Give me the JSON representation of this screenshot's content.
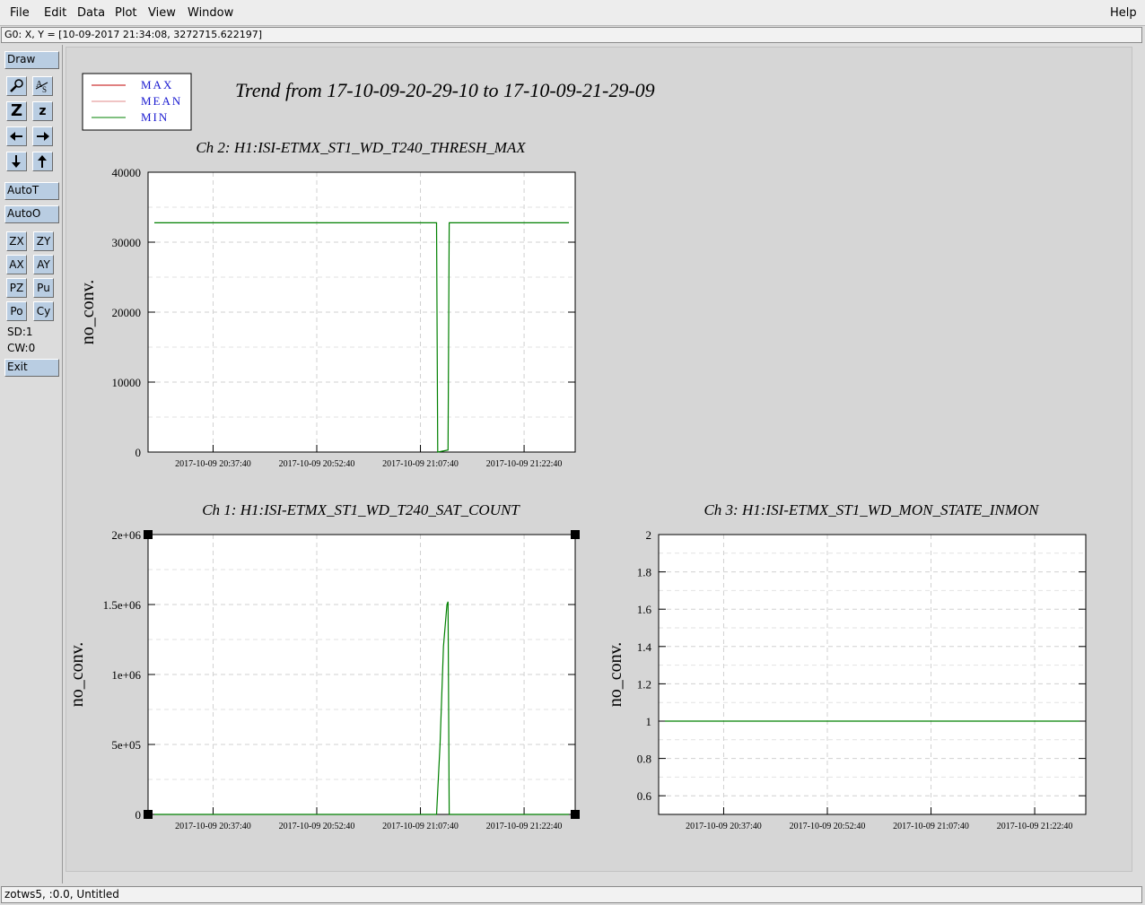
{
  "menu": {
    "file": "File",
    "edit": "Edit",
    "data": "Data",
    "plot": "Plot",
    "view": "View",
    "window": "Window",
    "help": "Help"
  },
  "coord_readout": "G0: X, Y = [10-09-2017 21:34:08, 3272715.622197]",
  "toolbar": {
    "draw": "Draw",
    "zoom_big": "Z",
    "zoom_small": "z",
    "autot": "AutoT",
    "autoo": "AutoO",
    "zx": "ZX",
    "zy": "ZY",
    "ax": "AX",
    "ay": "AY",
    "pz": "PZ",
    "pu": "Pu",
    "po": "Po",
    "cy": "Cy",
    "sd": "SD:1",
    "cw": "CW:0",
    "exit": "Exit",
    "icons": [
      "magnifier-icon",
      "text-tool-icon",
      "arrow-left-icon",
      "arrow-right-icon",
      "arrow-down-icon",
      "arrow-up-icon"
    ]
  },
  "legend": {
    "entries": [
      {
        "name": "MAX",
        "color": "#c00000"
      },
      {
        "name": "MEAN",
        "color": "#e08a8a"
      },
      {
        "name": "MIN",
        "color": "#008000"
      }
    ]
  },
  "title": "Trend from 17-10-09-20-29-10 to 17-10-09-21-29-09",
  "status": "zotws5, :0.0, Untitled",
  "chart_data": [
    {
      "type": "line",
      "title": "Ch 2: H1:ISI-ETMX_ST1_WD_T240_THRESH_MAX",
      "ylabel": "no_conv.",
      "xlabel": "",
      "x_ticks": [
        "2017-10-09 20:37:40",
        "2017-10-09 20:52:40",
        "2017-10-09 21:07:40",
        "2017-10-09 21:22:40"
      ],
      "y_ticks": [
        "0",
        "10000",
        "20000",
        "30000",
        "40000"
      ],
      "xlim": [
        "2017-10-09 20:29:10",
        "2017-10-09 21:29:09"
      ],
      "ylim": [
        0,
        40000
      ],
      "grid": true,
      "series": [
        {
          "name": "MIN",
          "color": "#008000",
          "x": [
            "2017-10-09 20:29:10",
            "2017-10-09 21:10:00",
            "2017-10-09 21:10:10",
            "2017-10-09 21:11:40",
            "2017-10-09 21:11:50",
            "2017-10-09 21:29:09"
          ],
          "y": [
            32768,
            32768,
            0,
            300,
            32768,
            32768
          ]
        }
      ]
    },
    {
      "type": "line",
      "title": "Ch 1: H1:ISI-ETMX_ST1_WD_T240_SAT_COUNT",
      "ylabel": "no_conv.",
      "xlabel": "",
      "x_ticks": [
        "2017-10-09 20:37:40",
        "2017-10-09 20:52:40",
        "2017-10-09 21:07:40",
        "2017-10-09 21:22:40"
      ],
      "y_ticks": [
        "0",
        "5e+05",
        "1e+06",
        "1.5e+06",
        "2e+06"
      ],
      "xlim": [
        "2017-10-09 20:29:10",
        "2017-10-09 21:29:09"
      ],
      "ylim": [
        0,
        2000000
      ],
      "grid": true,
      "series": [
        {
          "name": "MIN",
          "color": "#008000",
          "x": [
            "2017-10-09 20:29:10",
            "2017-10-09 21:10:00",
            "2017-10-09 21:10:30",
            "2017-10-09 21:11:00",
            "2017-10-09 21:11:30",
            "2017-10-09 21:11:40",
            "2017-10-09 21:11:50",
            "2017-10-09 21:29:09"
          ],
          "y": [
            0,
            0,
            500000,
            1200000,
            1500000,
            1520000,
            0,
            0
          ]
        }
      ]
    },
    {
      "type": "line",
      "title": "Ch 3: H1:ISI-ETMX_ST1_WD_MON_STATE_INMON",
      "ylabel": "no_conv.",
      "xlabel": "",
      "x_ticks": [
        "2017-10-09 20:37:40",
        "2017-10-09 20:52:40",
        "2017-10-09 21:07:40",
        "2017-10-09 21:22:40"
      ],
      "y_ticks": [
        "0.6",
        "0.8",
        "1",
        "1.2",
        "1.4",
        "1.6",
        "1.8",
        "2"
      ],
      "xlim": [
        "2017-10-09 20:29:10",
        "2017-10-09 21:29:09"
      ],
      "ylim": [
        0.5,
        2
      ],
      "grid": true,
      "series": [
        {
          "name": "MIN",
          "color": "#008000",
          "x": [
            "2017-10-09 20:29:10",
            "2017-10-09 21:29:09"
          ],
          "y": [
            1,
            1
          ]
        }
      ]
    }
  ]
}
